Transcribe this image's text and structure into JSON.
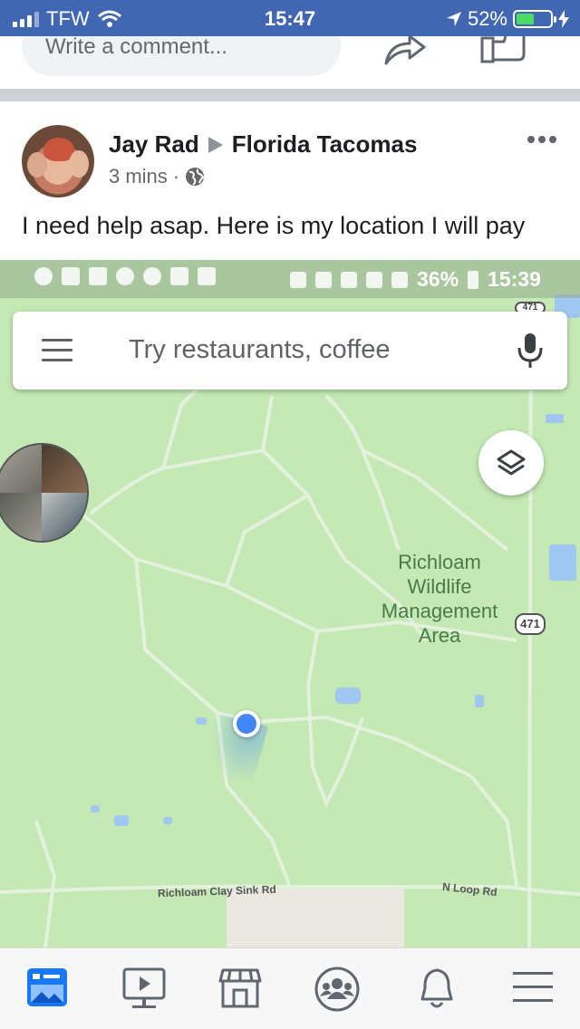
{
  "status_bar": {
    "carrier": "TFW",
    "time": "15:47",
    "battery_percent": "52%",
    "battery_level": 0.52
  },
  "comment_bar": {
    "placeholder": "Write a comment..."
  },
  "post": {
    "author": "Jay Rad",
    "group": "Florida Tacomas",
    "time_ago": "3 mins",
    "separator": "·",
    "privacy_icon": "globe-icon",
    "text": "I need help asap. Here is my location I will pay"
  },
  "map_screenshot": {
    "status_bar": {
      "battery_percent": "36%",
      "time": "15:39"
    },
    "search_placeholder": "Try restaurants, coffee",
    "area_label": "Richloam\nWildlife\nManagement\nArea",
    "highway_shield": "471",
    "roads": [
      "Richloam Clay Sink Rd",
      "N Loop Rd"
    ]
  },
  "tab_bar": {
    "items": [
      "news-feed-icon",
      "watch-icon",
      "marketplace-icon",
      "groups-icon",
      "notifications-icon",
      "menu-icon"
    ]
  },
  "colors": {
    "facebook_blue": "#4267b2",
    "map_green": "#c4e9b4",
    "location_blue": "#4285f4"
  }
}
